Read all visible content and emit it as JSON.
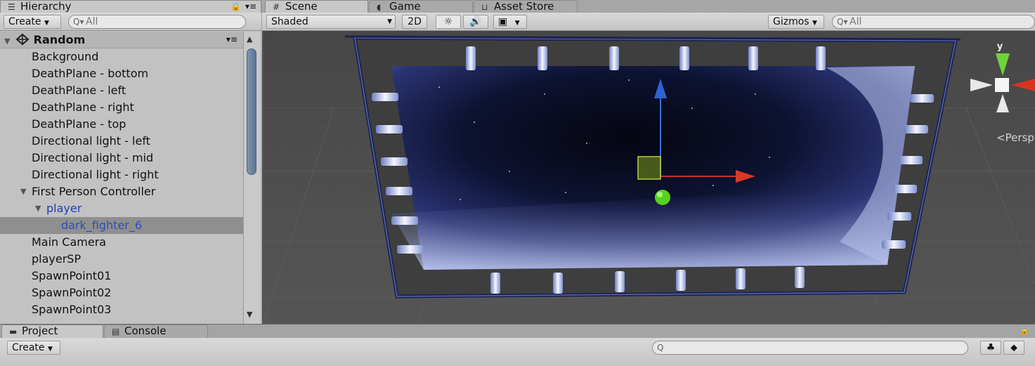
{
  "hierarchy": {
    "tab": "Hierarchy",
    "create": "Create",
    "search_placeholder": "All",
    "root": "Random",
    "items": [
      {
        "label": "Background",
        "indent": 0,
        "arrow": false,
        "selected": false,
        "prefab": false
      },
      {
        "label": "DeathPlane - bottom",
        "indent": 0,
        "arrow": false,
        "selected": false,
        "prefab": false
      },
      {
        "label": "DeathPlane - left",
        "indent": 0,
        "arrow": false,
        "selected": false,
        "prefab": false
      },
      {
        "label": "DeathPlane - right",
        "indent": 0,
        "arrow": false,
        "selected": false,
        "prefab": false
      },
      {
        "label": "DeathPlane - top",
        "indent": 0,
        "arrow": false,
        "selected": false,
        "prefab": false
      },
      {
        "label": "Directional light - left",
        "indent": 0,
        "arrow": false,
        "selected": false,
        "prefab": false
      },
      {
        "label": "Directional light - mid",
        "indent": 0,
        "arrow": false,
        "selected": false,
        "prefab": false
      },
      {
        "label": "Directional light - right",
        "indent": 0,
        "arrow": false,
        "selected": false,
        "prefab": false
      },
      {
        "label": "First Person Controller",
        "indent": 0,
        "arrow": true,
        "selected": false,
        "prefab": false
      },
      {
        "label": "player",
        "indent": 1,
        "arrow": true,
        "selected": false,
        "prefab": true
      },
      {
        "label": "dark_fighter_6",
        "indent": 2,
        "arrow": false,
        "selected": true,
        "prefab": true
      },
      {
        "label": "Main Camera",
        "indent": 0,
        "arrow": false,
        "selected": false,
        "prefab": false
      },
      {
        "label": "playerSP",
        "indent": 0,
        "arrow": false,
        "selected": false,
        "prefab": false
      },
      {
        "label": "SpawnPoint01",
        "indent": 0,
        "arrow": false,
        "selected": false,
        "prefab": false
      },
      {
        "label": "SpawnPoint02",
        "indent": 0,
        "arrow": false,
        "selected": false,
        "prefab": false
      },
      {
        "label": "SpawnPoint03",
        "indent": 0,
        "arrow": false,
        "selected": false,
        "prefab": false
      }
    ]
  },
  "scene": {
    "tabs": [
      "Scene",
      "Game",
      "Asset Store"
    ],
    "shading": "Shaded",
    "mode_2d": "2D",
    "gizmos": "Gizmos",
    "search_placeholder": "All",
    "axis_y": "y",
    "persp": "Persp"
  },
  "bottom": {
    "tabs": [
      "Project",
      "Console"
    ],
    "create": "Create"
  },
  "icons": {
    "hierarchy": "list-icon",
    "scene": "grid-icon",
    "game": "pacman-icon",
    "asset_store": "shopping-bag-icon",
    "project": "folder-icon",
    "console": "console-icon"
  }
}
